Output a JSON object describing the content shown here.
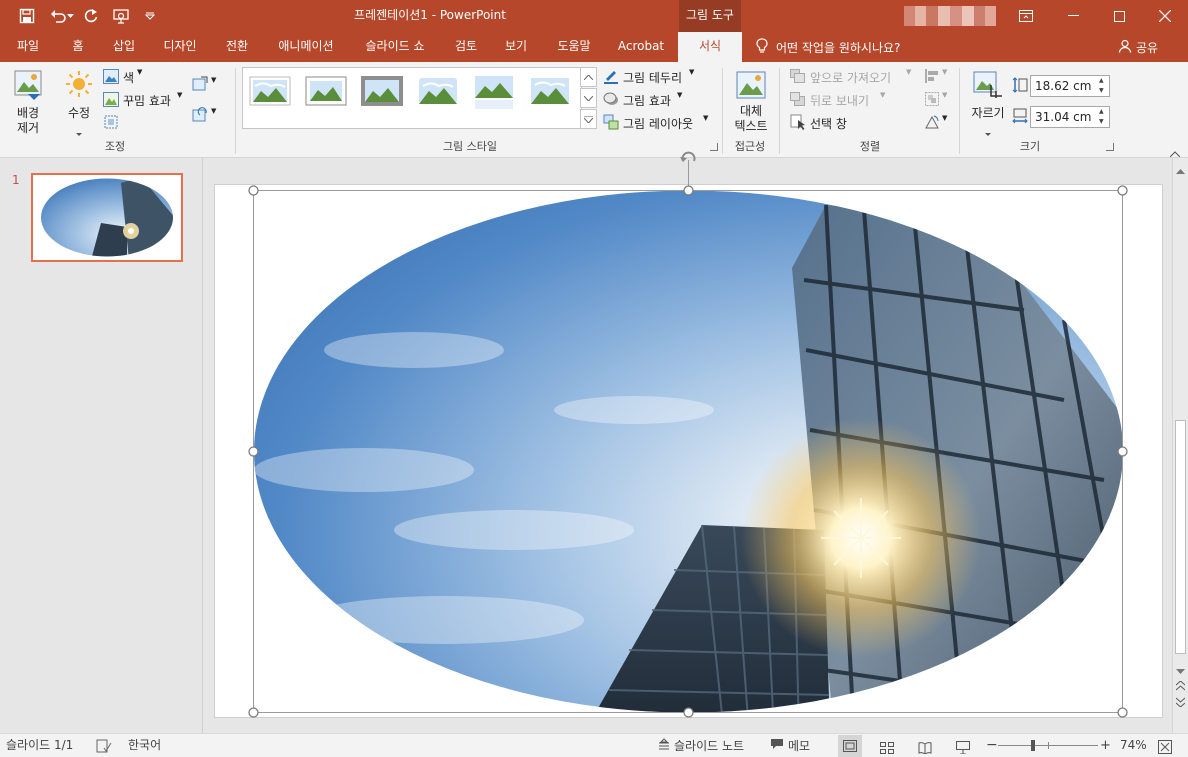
{
  "window": {
    "doc_title": "프레젠테이션1  -  PowerPoint",
    "tool_context": "그림 도구"
  },
  "tabs": [
    "파일",
    "홈",
    "삽입",
    "디자인",
    "전환",
    "애니메이션",
    "슬라이드 쇼",
    "검토",
    "보기",
    "도움말",
    "Acrobat",
    "서식"
  ],
  "active_tab": "서식",
  "tell_me": "어떤 작업을 원하시나요?",
  "share": "공유",
  "ribbon": {
    "remove_bg_line1": "배경",
    "remove_bg_line2": "제거",
    "corrections": "수정",
    "color": "색",
    "artistic_effects": "꾸밈 효과",
    "group_adjust": "조정",
    "group_styles": "그림 스타일",
    "picture_border": "그림 테두리",
    "picture_effects": "그림 효과",
    "picture_layout": "그림 레이아웃",
    "alt_text_line1": "대체",
    "alt_text_line2": "텍스트",
    "group_access": "접근성",
    "bring_forward": "앞으로 가져오기",
    "send_backward": "뒤로 보내기",
    "selection_pane": "선택 창",
    "group_arrange": "정렬",
    "crop": "자르기",
    "height": "18.62 cm",
    "width": "31.04 cm",
    "group_size": "크기"
  },
  "thumbnails": {
    "slide_number": "1"
  },
  "status": {
    "slide_indicator": "슬라이드 1/1",
    "language": "한국어",
    "notes": "슬라이드 노트",
    "comments": "메모",
    "zoom": "74%"
  },
  "colors": {
    "accent": "#b7472a",
    "accent_dark": "#973c24",
    "thumb_border": "#e4704f",
    "ribbon_bg": "#f3f3f3"
  }
}
